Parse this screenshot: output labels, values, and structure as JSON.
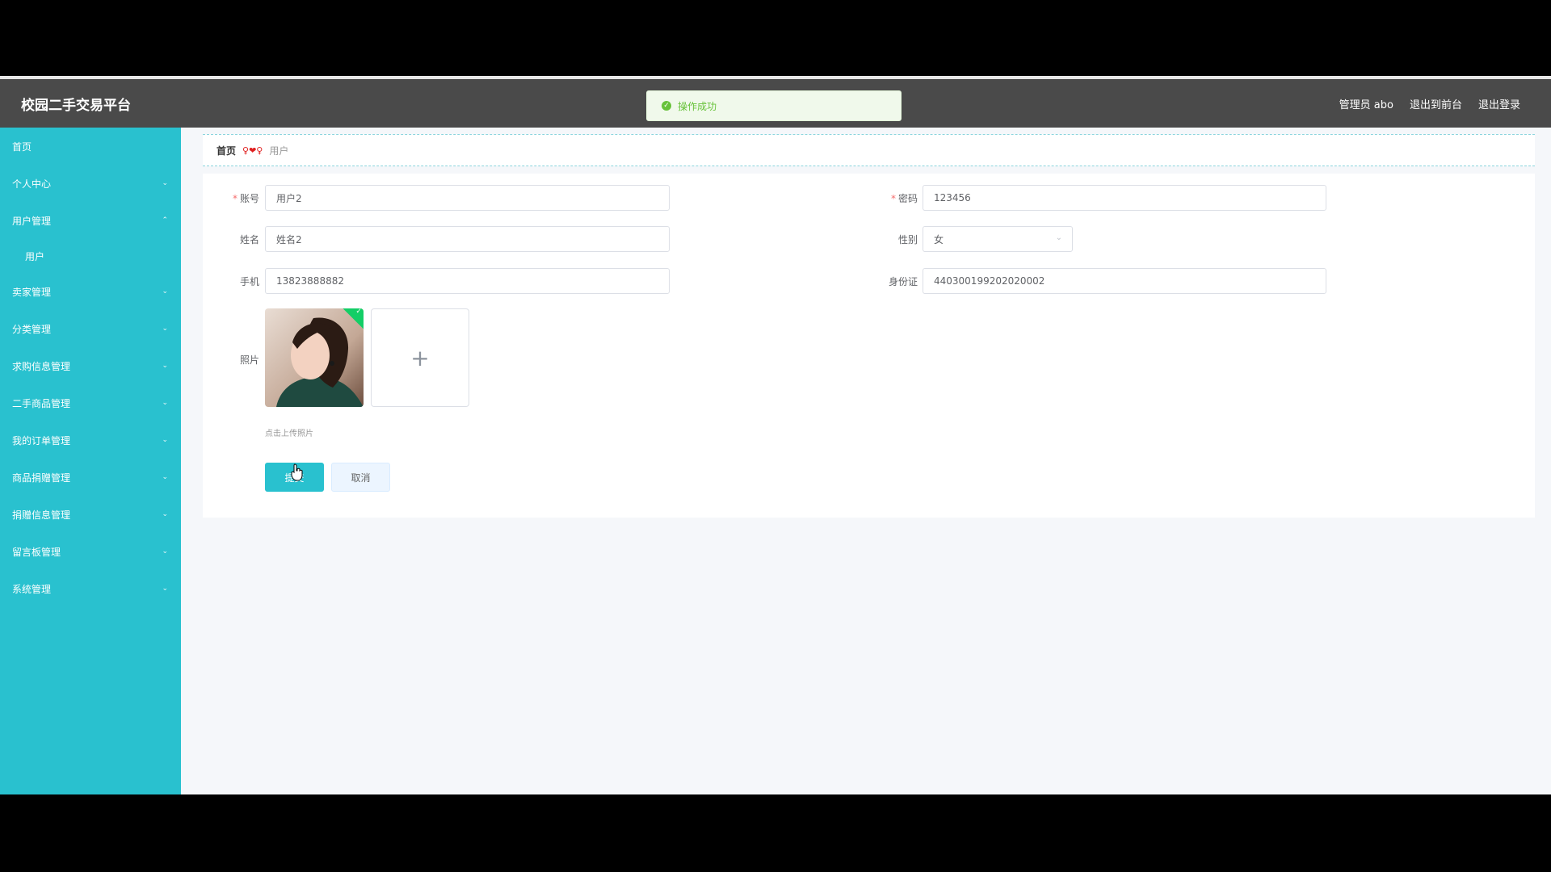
{
  "header": {
    "brand": "校园二手交易平台",
    "user": "管理员 abo",
    "to_front": "退出到前台",
    "logout": "退出登录"
  },
  "toast": {
    "message": "操作成功",
    "icon": "check-circle-icon"
  },
  "sidebar": {
    "items": [
      {
        "label": "首页"
      },
      {
        "label": "个人中心"
      },
      {
        "label": "用户管理",
        "expanded": true,
        "children": [
          "用户"
        ]
      },
      {
        "label": "卖家管理"
      },
      {
        "label": "分类管理"
      },
      {
        "label": "求购信息管理"
      },
      {
        "label": "二手商品管理"
      },
      {
        "label": "我的订单管理"
      },
      {
        "label": "商品捐赠管理"
      },
      {
        "label": "捐赠信息管理"
      },
      {
        "label": "留言板管理"
      },
      {
        "label": "系统管理"
      }
    ]
  },
  "breadcrumb": {
    "home": "首页",
    "separator": "♀❤♀",
    "current": "用户"
  },
  "form": {
    "account_label": "账号",
    "account_value": "用户2",
    "password_label": "密码",
    "password_value": "123456",
    "name_label": "姓名",
    "name_value": "姓名2",
    "gender_label": "性别",
    "gender_value": "女",
    "phone_label": "手机",
    "phone_value": "13823888882",
    "idcard_label": "身份证",
    "idcard_value": "440300199202020002",
    "photo_label": "照片",
    "upload_tip": "点击上传照片",
    "submit": "提交",
    "cancel": "取消"
  },
  "colors": {
    "accent": "#29c1cf",
    "header": "#4a4a4a",
    "success": "#67c23a"
  }
}
